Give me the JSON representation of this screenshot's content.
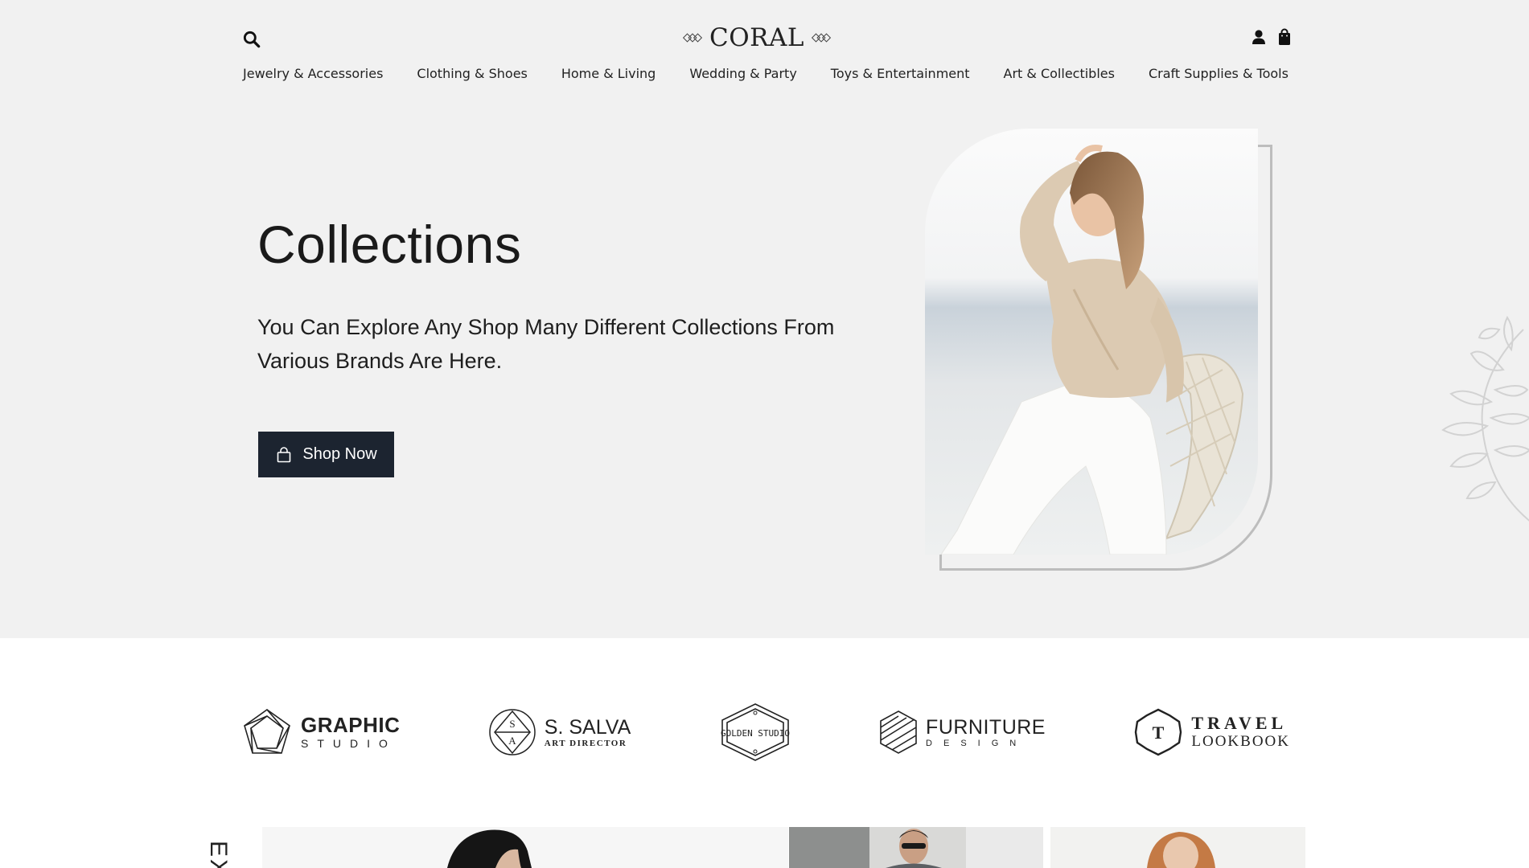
{
  "header": {
    "brand_name": "CORAL",
    "icons": [
      "search-icon",
      "user-icon",
      "shopping-bag-icon"
    ]
  },
  "nav": {
    "items": [
      {
        "label": "Jewelry & Accessories"
      },
      {
        "label": "Clothing & Shoes"
      },
      {
        "label": "Home & Living"
      },
      {
        "label": "Wedding & Party"
      },
      {
        "label": "Toys & Entertainment"
      },
      {
        "label": "Art & Collectibles"
      },
      {
        "label": "Craft Supplies & Tools"
      }
    ]
  },
  "hero": {
    "title": "Collections",
    "description": "You Can Explore Any Shop Many Different Collections From Various Brands Are Here.",
    "button_label": "Shop Now",
    "background_color": "#f1f1f1",
    "button_color": "#1c2430"
  },
  "brands": {
    "items": [
      {
        "name": "GRAPHIC",
        "tagline": "STUDIO"
      },
      {
        "name": "S. SALVA",
        "tagline": "ART DIRECTOR",
        "mark_letters": "SA"
      },
      {
        "name": "GOLDEN STUDIO"
      },
      {
        "name": "FURNITURE",
        "tagline": "DESIGN"
      },
      {
        "name": "TRAVEL",
        "tagline": "LOOKBOOK",
        "mark_letter": "T"
      }
    ]
  },
  "bottom": {
    "vertical_text": "EX"
  }
}
